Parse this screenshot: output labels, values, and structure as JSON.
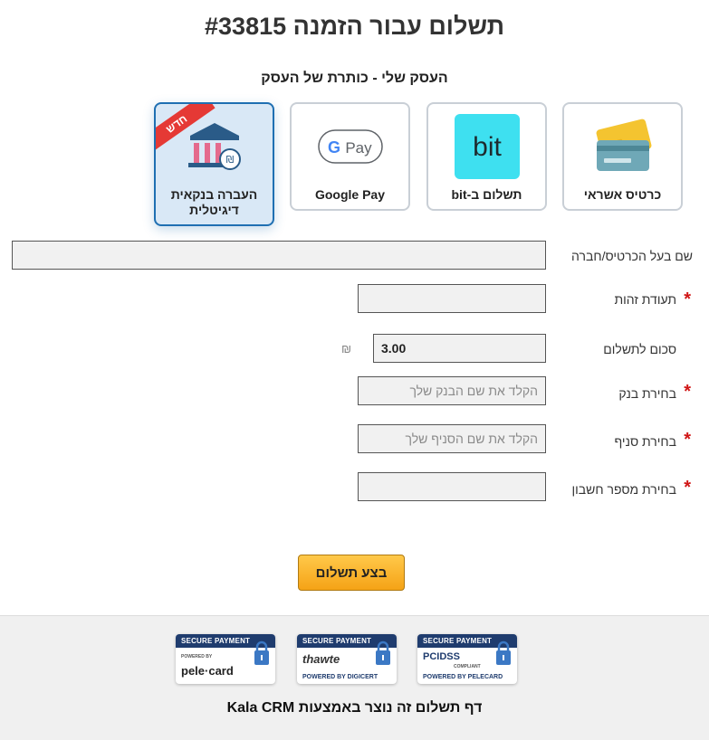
{
  "header": {
    "title": "תשלום עבור הזמנה #33815",
    "subtitle": "העסק שלי - כותרת של העסק"
  },
  "payment_methods": [
    {
      "label": "כרטיס אשראי",
      "icon": "credit-card-icon",
      "selected": false
    },
    {
      "label": "תשלום ב-bit",
      "icon": "bit-logo-icon",
      "selected": false,
      "logo_text": "bit",
      "logo_color": "#3ee0f0"
    },
    {
      "label": "Google Pay",
      "icon": "google-pay-icon",
      "selected": false,
      "logo_text": "Pay"
    },
    {
      "label": "העברה בנקאית דיגיטלית",
      "icon": "bank-icon",
      "selected": true,
      "ribbon": "חדש"
    }
  ],
  "form": {
    "card_holder": {
      "label": "שם בעל הכרטיס/חברה",
      "value": "",
      "required": false
    },
    "id_number": {
      "label": "תעודת זהות",
      "value": "",
      "required": true
    },
    "amount": {
      "label": "סכום לתשלום",
      "value": "3.00",
      "currency": "₪",
      "required": false
    },
    "bank": {
      "label": "בחירת בנק",
      "placeholder": "הקלד את שם הבנק שלך",
      "required": true
    },
    "branch": {
      "label": "בחירת סניף",
      "placeholder": "הקלד את שם הסניף שלך",
      "required": true
    },
    "account": {
      "label": "בחירת מספר חשבון",
      "value": "",
      "required": true
    },
    "required_mark": "*"
  },
  "submit": {
    "label": "בצע תשלום"
  },
  "footer": {
    "badges": [
      {
        "head": "SECURE PAYMENT",
        "brand": "DSS",
        "sub": "POWERED BY PELECARD",
        "tiny": "COMPLIANT",
        "prefix": "PCI"
      },
      {
        "head": "SECURE PAYMENT",
        "brand": "thawte",
        "sub": "POWERED BY DIGICERT"
      },
      {
        "head": "SECURE PAYMENT",
        "brand": "pele·card",
        "tiny": "POWERED BY"
      }
    ],
    "credit": "דף תשלום זה נוצר באמצעות Kala CRM"
  },
  "colors": {
    "accent": "#1f6fb2",
    "required": "#d01515",
    "submit": "#f5a316",
    "badge_navy": "#1f3c6e"
  }
}
